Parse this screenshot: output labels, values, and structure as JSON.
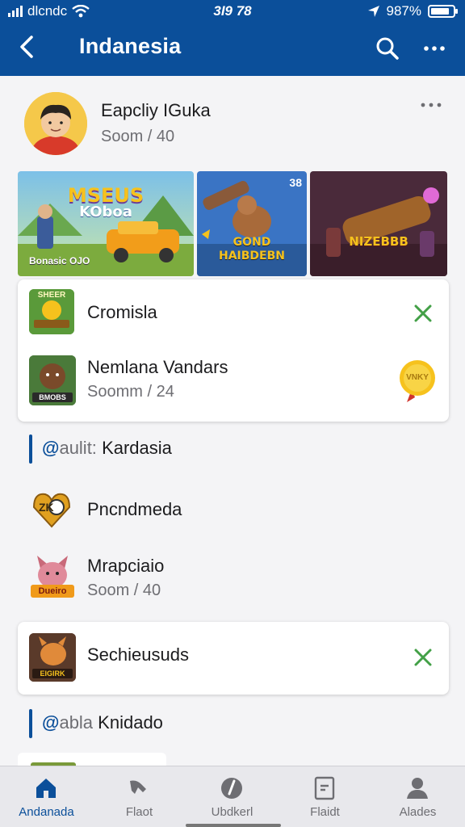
{
  "status_bar": {
    "carrier": "dlcndc",
    "time": "3I9 78",
    "battery": "987%",
    "battery_level": 0.85
  },
  "app_bar": {
    "title": "Indanesia",
    "back_icon": "chevron-left-icon",
    "search_icon": "search-icon",
    "more_icon": "more-horizontal-icon"
  },
  "profile": {
    "name": "Eapcliy IGuka",
    "sub": "Soom / 40"
  },
  "banners": [
    {
      "caption_top": "MSEUS",
      "caption_mid": "KOboa",
      "caption_bottom": "Bonasic OJO"
    },
    {
      "badge": "38",
      "caption": "GOND\nHAIBDEBN"
    },
    {
      "caption": "NIZEBBB"
    }
  ],
  "card1": {
    "items": [
      {
        "title": "Cromisla",
        "icon_text": "SHEER",
        "action": "close-icon"
      },
      {
        "title": "Nemlana Vandars",
        "sub": "Soomm / 24",
        "icon_text": "BMOBS",
        "badge_text": "VNKY",
        "action": "medal-icon"
      }
    ]
  },
  "section1": {
    "at": "@",
    "muted": "aulit:",
    "label": "Kardasia"
  },
  "list": [
    {
      "title": "Pncndmeda",
      "icon_text": "ZK"
    },
    {
      "title": "Mrapciaio",
      "sub": "Soom / 40",
      "icon_text": "Dueiro"
    }
  ],
  "card2": {
    "title": "Sechieusuds",
    "icon_text": "EIGIRK",
    "action": "close-icon"
  },
  "section2": {
    "at": "@",
    "muted": "abla",
    "label": "Knidado"
  },
  "bottom_nav": [
    {
      "label": "Andanada",
      "icon": "home-icon",
      "active": true
    },
    {
      "label": "Flaot",
      "icon": "share-icon",
      "active": false
    },
    {
      "label": "Ubdkerl",
      "icon": "brush-icon",
      "active": false
    },
    {
      "label": "Flaidt",
      "icon": "document-icon",
      "active": false
    },
    {
      "label": "Alades",
      "icon": "person-icon",
      "active": false
    }
  ],
  "colors": {
    "primary": "#0b4f9a",
    "accent_green": "#43a047",
    "background": "#f4f4f6"
  }
}
